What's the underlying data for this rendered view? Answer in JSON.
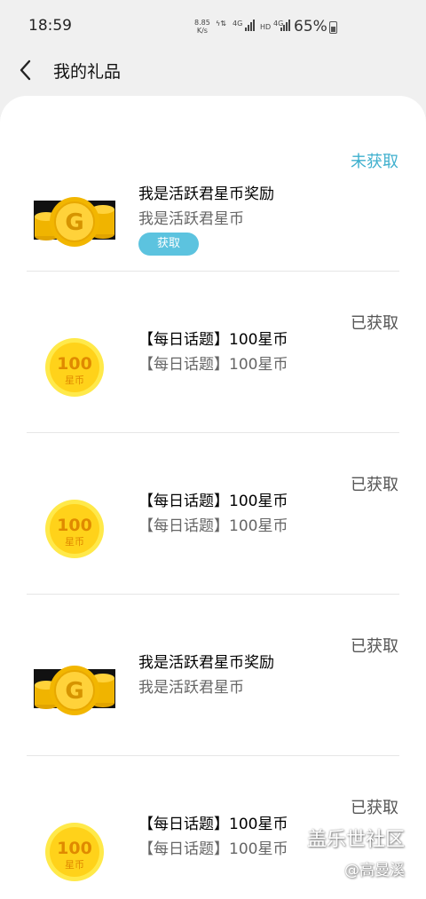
{
  "status_bar": {
    "time": "18:59",
    "speed_top": "8.85",
    "speed_bottom": "K/s",
    "network_1": "4G",
    "hd": "HD",
    "network_2": "4G",
    "battery": "65%"
  },
  "header": {
    "title": "我的礼品"
  },
  "gifts": [
    {
      "status": "未获取",
      "name": "我是活跃君星币奖励",
      "desc": "我是活跃君星币",
      "button": "获取",
      "image": "gold-coins-icon"
    },
    {
      "status": "已获取",
      "name": "【每日话题】100星币",
      "desc": "【每日话题】100星币",
      "image": "coin-100-icon",
      "coin_value": "100",
      "coin_unit": "星币"
    },
    {
      "status": "已获取",
      "name": "【每日话题】100星币",
      "desc": "【每日话题】100星币",
      "image": "coin-100-icon",
      "coin_value": "100",
      "coin_unit": "星币"
    },
    {
      "status": "已获取",
      "name": "我是活跃君星币奖励",
      "desc": "我是活跃君星币",
      "image": "gold-coins-icon"
    },
    {
      "status": "已获取",
      "name": "【每日话题】100星币",
      "desc": "【每日话题】100星币",
      "image": "coin-100-icon",
      "coin_value": "100",
      "coin_unit": "星币"
    }
  ],
  "watermark": {
    "line1": "盖乐世社区",
    "line2": "@高曼溪"
  },
  "colors": {
    "accent": "#5cc3df",
    "pending_status": "#3fb0ce",
    "coin_gold": "#f5c518"
  }
}
